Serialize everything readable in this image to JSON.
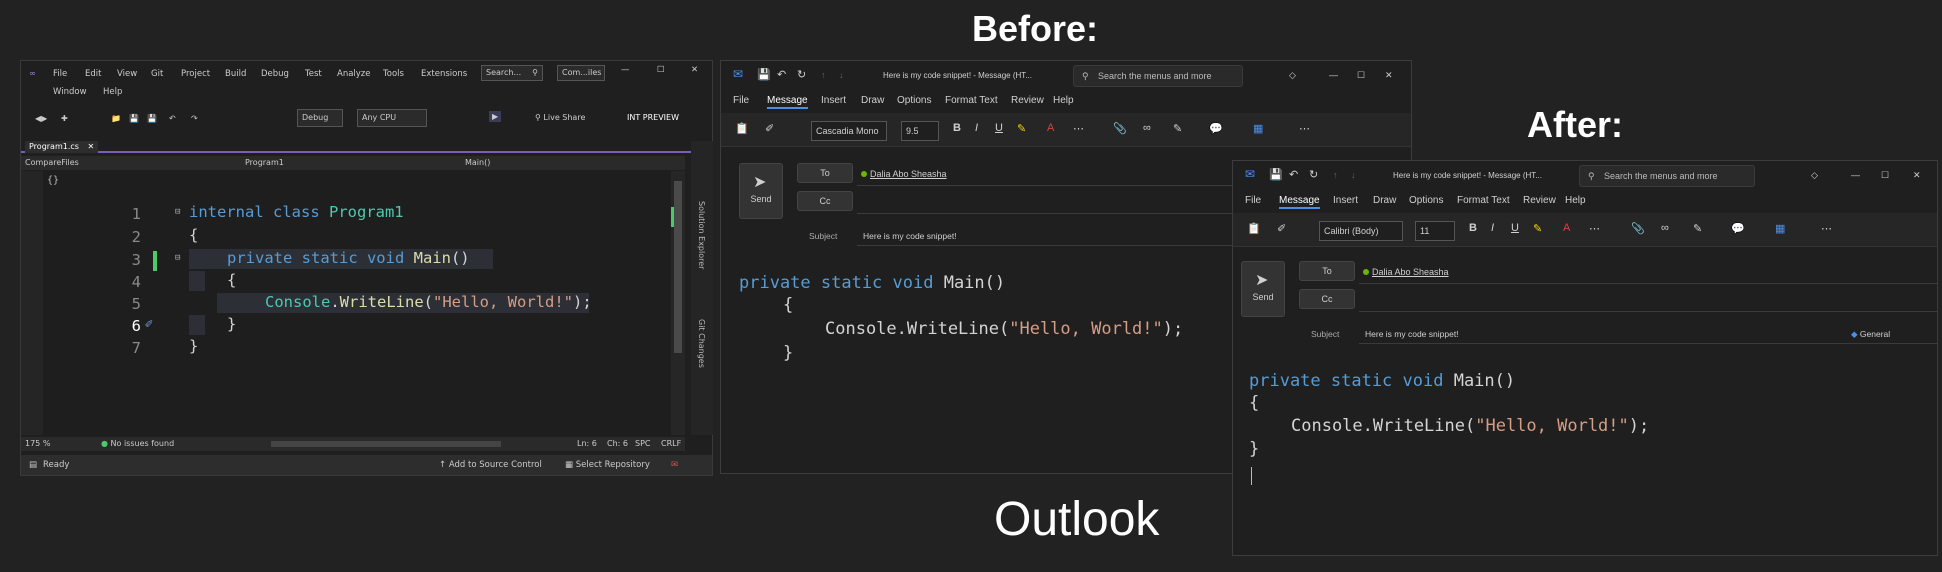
{
  "labels": {
    "before": "Before:",
    "after": "After:",
    "outlook": "Outlook"
  },
  "vs": {
    "menu": [
      "File",
      "Edit",
      "View",
      "Git",
      "Project",
      "Build",
      "Debug",
      "Test",
      "Analyze",
      "Tools",
      "Extensions"
    ],
    "menu2": [
      "Window",
      "Help"
    ],
    "search_label": "Search...",
    "solution_name": "Com...iles",
    "config": "Debug",
    "platform": "Any CPU",
    "live_share": "Live Share",
    "int_preview": "INT PREVIEW",
    "tab_name": "Program1.cs",
    "nav_project": "CompareFiles",
    "nav_class": "Program1",
    "nav_member": "Main()",
    "line_numbers": [
      "1",
      "2",
      "3",
      "4",
      "5",
      "6",
      "7"
    ],
    "code": {
      "l1_kw": "internal class ",
      "l1_cls": "Program1",
      "l2": "{",
      "l3_kw": "private static void ",
      "l3_fn": "Main",
      "l3_rest": "()",
      "l4": "{",
      "l5_cls": "Console",
      "l5_dot": ".",
      "l5_fn": "WriteLine",
      "l5_open": "(",
      "l5_str": "\"Hello, World!\"",
      "l5_close": ");",
      "l6": "}",
      "l7": "}"
    },
    "zoom": "175 %",
    "issues": "No issues found",
    "ln": "Ln: 6",
    "ch": "Ch: 6",
    "spc": "SPC",
    "crlf": "CRLF",
    "ready": "Ready",
    "add_to_source": "Add to Source Control",
    "select_repo": "Select Repository",
    "rail_solution": "Solution Explorer",
    "rail_git": "Git Changes"
  },
  "outlook_before": {
    "title": "Here is my code snippet! - Message (HT...",
    "search": "Search the menus and more",
    "tabs": [
      "File",
      "Message",
      "Insert",
      "Draw",
      "Options",
      "Format Text",
      "Review",
      "Help"
    ],
    "font": "Cascadia Mono",
    "size": "9.5",
    "send": "Send",
    "to": "To",
    "cc": "Cc",
    "recipient": "Dalia Abo Sheasha",
    "subject_label": "Subject",
    "subject": "Here is my code snippet!",
    "code": {
      "l1_kw": "private static void ",
      "l1_rest": "Main()",
      "l2": "{",
      "l3_a": "Console.WriteLine(",
      "l3_str": "\"Hello, World!\"",
      "l3_b": ");",
      "l4": "}"
    }
  },
  "outlook_after": {
    "title": "Here is my code snippet! - Message (HT...",
    "search": "Search the menus and more",
    "tabs": [
      "File",
      "Message",
      "Insert",
      "Draw",
      "Options",
      "Format Text",
      "Review",
      "Help"
    ],
    "font": "Calibri (Body)",
    "size": "11",
    "send": "Send",
    "to": "To",
    "cc": "Cc",
    "recipient": "Dalia Abo Sheasha",
    "subject_label": "Subject",
    "subject": "Here is my code snippet!",
    "sensitivity": "General",
    "code": {
      "l1_kw": "private static void ",
      "l1_rest": "Main()",
      "l2": "{",
      "l3_a": "Console.WriteLine(",
      "l3_str": "\"Hello, World!\"",
      "l3_b": ");",
      "l4": "}"
    }
  }
}
